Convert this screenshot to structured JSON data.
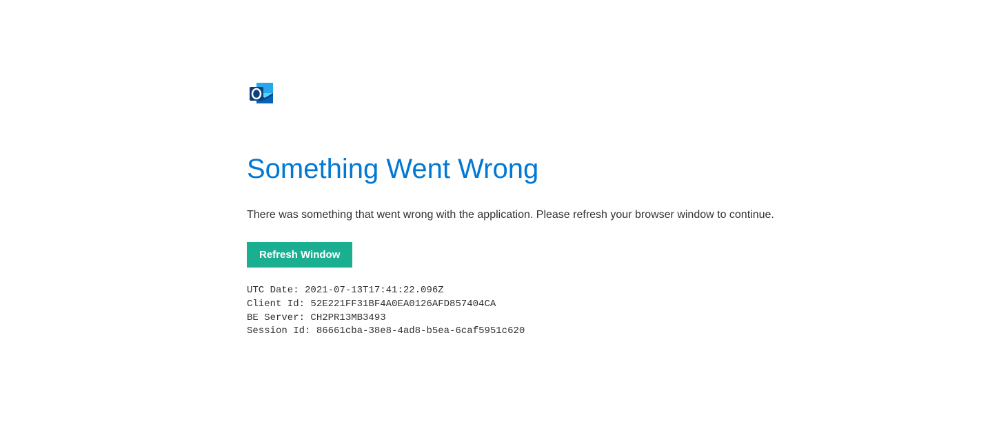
{
  "error": {
    "heading": "Something Went Wrong",
    "description": "There was something that went wrong with the application. Please refresh your browser window to continue.",
    "refresh_button_label": "Refresh Window"
  },
  "details": {
    "utc_date_label": "UTC Date: ",
    "utc_date_value": "2021-07-13T17:41:22.096Z",
    "client_id_label": "Client Id: ",
    "client_id_value": "52E221FF31BF4A0EA0126AFD857404CA",
    "be_server_label": "BE Server: ",
    "be_server_value": "CH2PR13MB3493",
    "session_id_label": "Session Id: ",
    "session_id_value": "86661cba-38e8-4ad8-b5ea-6caf5951c620"
  }
}
